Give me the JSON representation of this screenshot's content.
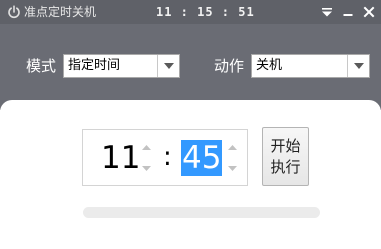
{
  "titlebar": {
    "title": "准点定时关机",
    "clock": "11 : 15 : 51",
    "icon": "power-icon",
    "buttons": [
      "menu-icon",
      "minimize-icon",
      "close-icon"
    ]
  },
  "toolbar": {
    "mode_label": "模式",
    "mode_value": "指定时间",
    "action_label": "动作",
    "action_value": "关机"
  },
  "timer": {
    "hour": "11",
    "separator": ":",
    "minute": "45"
  },
  "execute_button": {
    "line1": "开始",
    "line2": "执行"
  },
  "progress": {
    "percent": 0
  },
  "colors": {
    "titlebar": "#5f6168",
    "toolbar": "#6a6c74",
    "selection": "#3399ff",
    "progress_track": "#ebebeb"
  }
}
